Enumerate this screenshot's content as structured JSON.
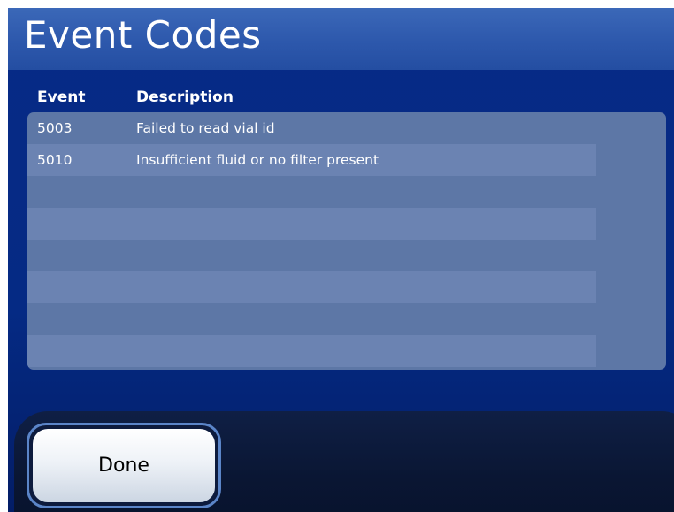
{
  "screen": {
    "title": "Event Codes"
  },
  "table": {
    "headers": {
      "event": "Event",
      "description": "Description"
    },
    "rows": [
      {
        "code": "5003",
        "description": "Failed to read vial id"
      },
      {
        "code": "5010",
        "description": "Insufficient fluid or no filter present"
      },
      {
        "code": "",
        "description": ""
      },
      {
        "code": "",
        "description": ""
      },
      {
        "code": "",
        "description": ""
      },
      {
        "code": "",
        "description": ""
      },
      {
        "code": "",
        "description": ""
      },
      {
        "code": "",
        "description": ""
      }
    ]
  },
  "footer": {
    "done_label": "Done"
  },
  "colors": {
    "background": "#052a84",
    "title_bar": "#2d58ac",
    "table_bg": "#5d77a6",
    "table_stripe": "#6b83b2",
    "footer_bg": "#0a1633",
    "button_border": "#5b85c8"
  }
}
